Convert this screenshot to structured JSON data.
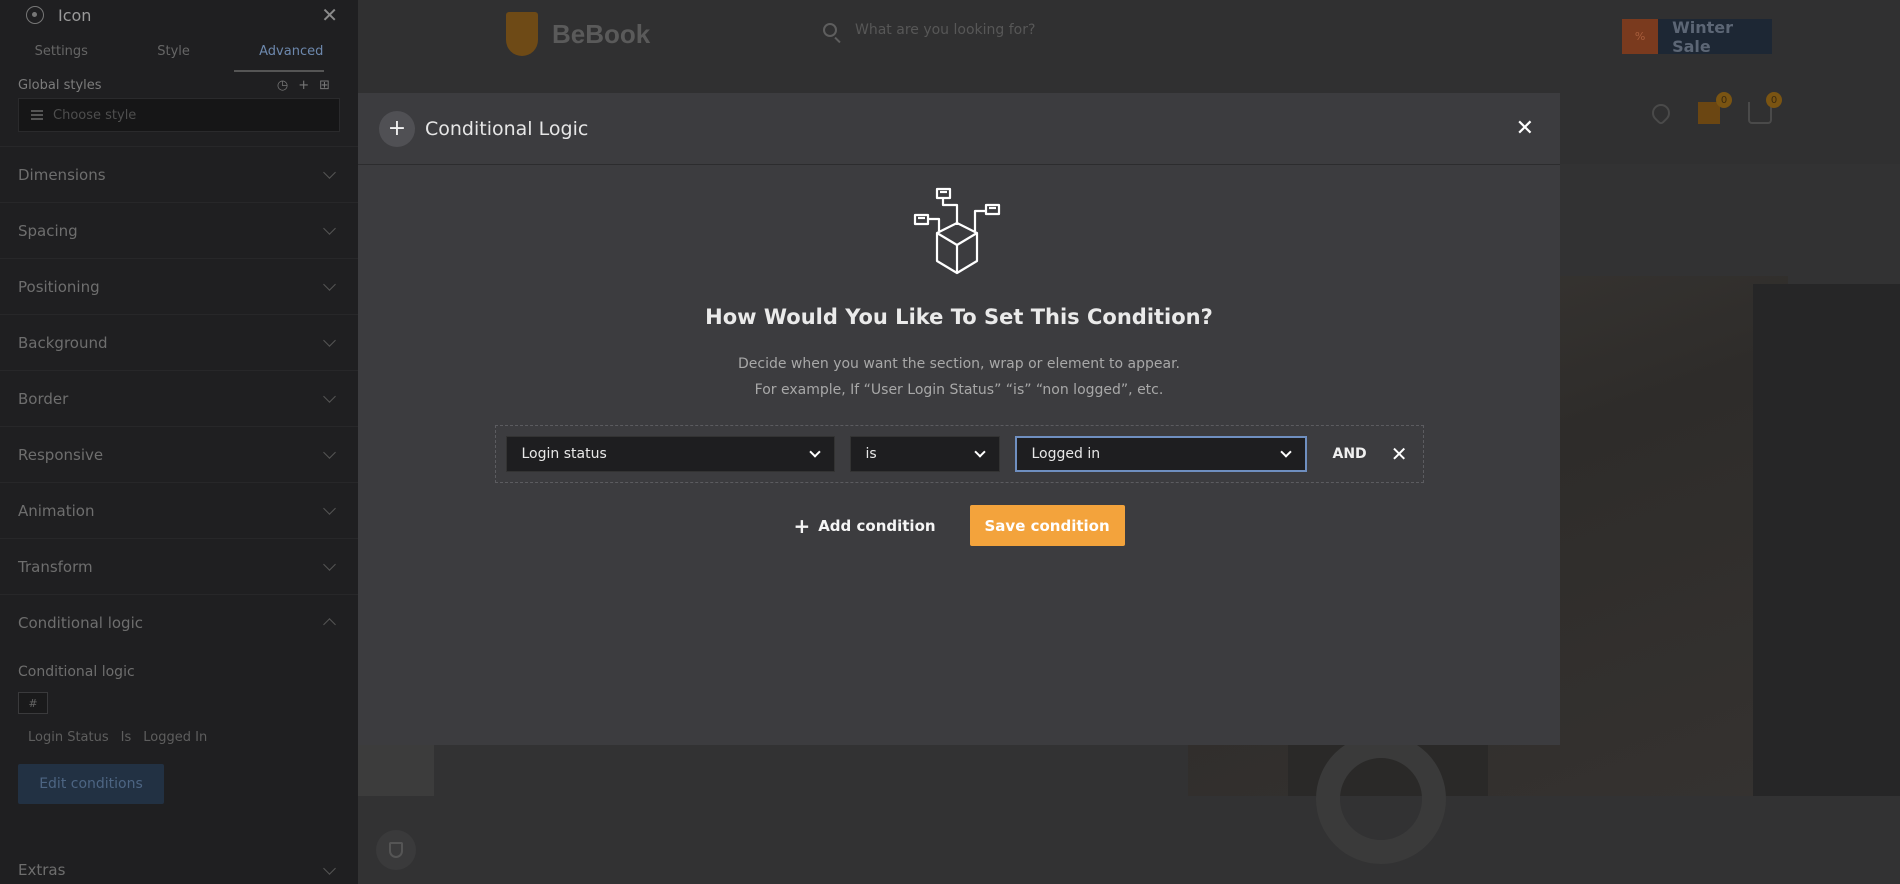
{
  "panel": {
    "title": "Icon",
    "tabs": [
      "Settings",
      "Style",
      "Advanced"
    ],
    "global_styles_label": "Global styles",
    "global_styles_placeholder": "Choose style",
    "sections": [
      "Dimensions",
      "Spacing",
      "Positioning",
      "Background",
      "Border",
      "Responsive",
      "Animation",
      "Transform",
      "Conditional logic"
    ],
    "conditional_logic_label": "Conditional logic",
    "summary": [
      "Login Status",
      "Is",
      "Logged In"
    ],
    "edit_button": "Edit conditions",
    "extras": "Extras"
  },
  "site": {
    "logo_text": "BeBook",
    "search_placeholder": "What are you looking for?",
    "promo_tag": "%",
    "promo_text": "Winter Sale",
    "wishlist_count": "0",
    "cart_count": "0"
  },
  "modal": {
    "title": "Conditional Logic",
    "heading": "How Would You Like To Set This Condition?",
    "desc_line1": "Decide when you want the section, wrap or element to appear.",
    "desc_line2": "For example, If “User Login Status” “is” “non logged”, etc.",
    "condition": {
      "field": "Login status",
      "operator": "is",
      "value": "Logged in",
      "joiner": "AND"
    },
    "add_condition": "Add condition",
    "save_condition": "Save condition"
  },
  "colors": {
    "accent": "#f3a33c",
    "focus_border": "#6f8fc0",
    "modal_bg": "#3c3c3f"
  }
}
